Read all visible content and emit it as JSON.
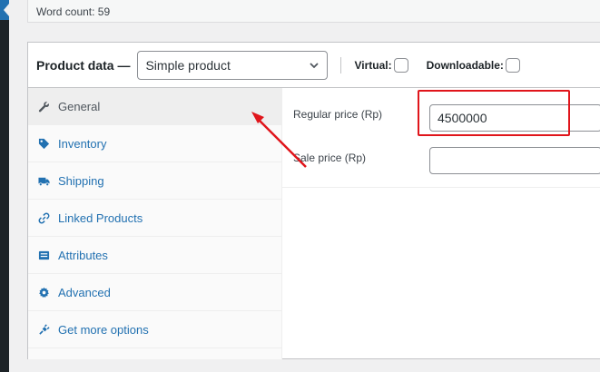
{
  "word_count": "Word count: 59",
  "product_data": {
    "title": "Product data —",
    "type_select": "Simple product",
    "virtual_label": "Virtual:",
    "downloadable_label": "Downloadable:"
  },
  "tabs": [
    {
      "label": "General",
      "icon": "wrench-icon"
    },
    {
      "label": "Inventory",
      "icon": "tag-icon"
    },
    {
      "label": "Shipping",
      "icon": "truck-icon"
    },
    {
      "label": "Linked Products",
      "icon": "link-icon"
    },
    {
      "label": "Attributes",
      "icon": "list-icon"
    },
    {
      "label": "Advanced",
      "icon": "gear-icon"
    },
    {
      "label": "Get more options",
      "icon": "plugin-icon"
    }
  ],
  "general": {
    "regular_price_label": "Regular price (Rp)",
    "regular_price_value": "4500000",
    "sale_price_label": "Sale price (Rp)",
    "sale_price_value": ""
  },
  "colors": {
    "accent": "#2271b1",
    "annotation": "#e0151b"
  }
}
